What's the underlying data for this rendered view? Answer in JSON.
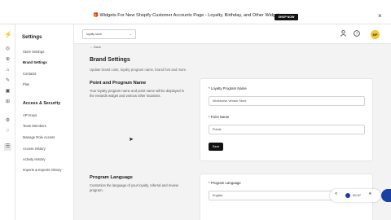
{
  "banner": {
    "text": "🎁 Widgets For New Shopify Customer Accounts Page - Loyalty, Birthday, and Other Widgets",
    "button": "SHOP NOW",
    "close": "×"
  },
  "rail": {
    "logo": "⚡",
    "icons": [
      "◎",
      "⊕",
      "⌂",
      "✎",
      "▣",
      "⊞",
      "⚙",
      "♢",
      "☰"
    ]
  },
  "sidebar": {
    "title": "Settings",
    "items": [
      "Store Settings",
      "Brand Settings",
      "Contacts",
      "Plan"
    ],
    "section": "Access & Security",
    "security_items": [
      "API Keys",
      "Team Members",
      "Manage Role Access",
      "Access History",
      "Activity History",
      "Imports & Exports History"
    ]
  },
  "topbar": {
    "store": "loyalty store",
    "help_icon": "?",
    "avatar": "MP"
  },
  "page": {
    "back": "← Back",
    "title": "Brand Settings",
    "subtitle": "Update brand color, loyalty program name, brand font and more."
  },
  "point_program": {
    "title": "Point and Program Name",
    "desc": "Your loyalty program name and point name will be displayed in the rewards widget and various other locations.",
    "program_label": "* Loyalty Program Name",
    "program_value": "Workhorse Vendor Store",
    "point_label": "* Point Name",
    "point_value": "Points",
    "save": "Save"
  },
  "program_language": {
    "title": "Program Language",
    "desc": "Customize the language of your loyalty, referral and review program.",
    "label": "* Program Language",
    "value": "English"
  },
  "player": {
    "back": "«",
    "time": "00:37",
    "pause": "⏸"
  },
  "colors": {
    "accent": "#e9b21a",
    "player": "#1a3fa3",
    "button": "#111111"
  }
}
